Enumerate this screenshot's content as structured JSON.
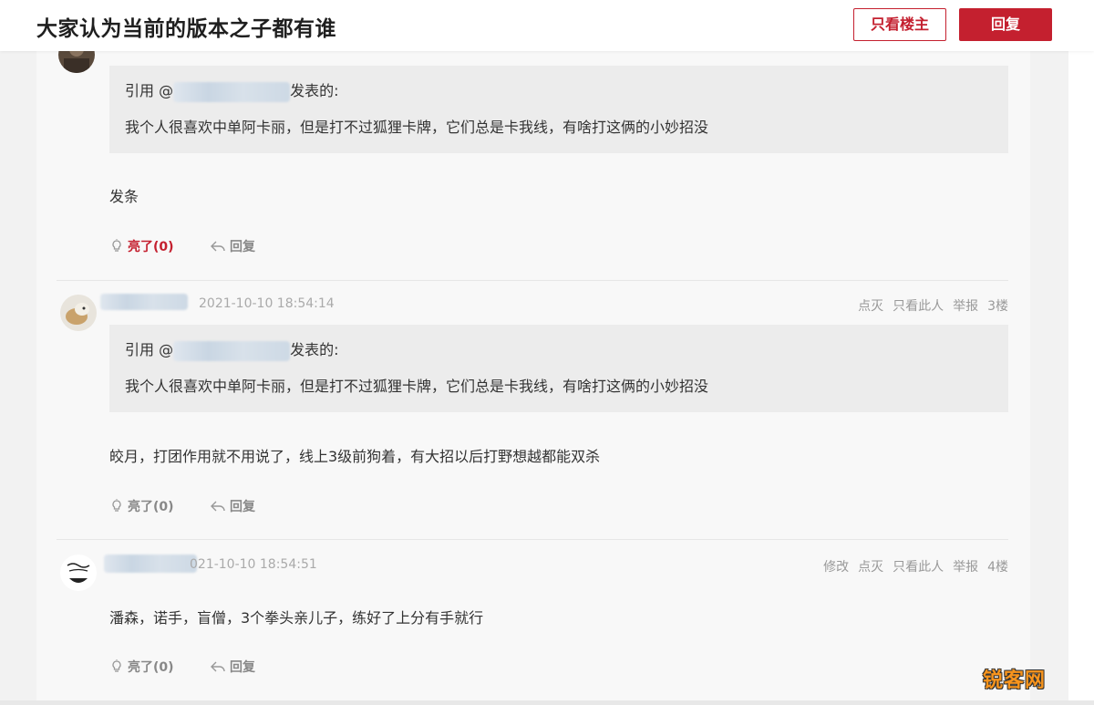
{
  "header": {
    "title": "大家认为当前的版本之子都有谁",
    "only_op_label": "只看楼主",
    "reply_label": "回复"
  },
  "posts": [
    {
      "quote_prefix": "引用 @",
      "quote_suffix": "发表的:",
      "quote_text": "我个人很喜欢中单阿卡丽，但是打不过狐狸卡牌，它们总是卡我线，有啥打这俩的小妙招没",
      "content": "发条",
      "like_label": "亮了(0)",
      "reply_label": "回复"
    },
    {
      "time": "2021-10-10 18:54:14",
      "menu": [
        "点灭",
        "只看此人",
        "举报",
        "3楼"
      ],
      "quote_prefix": "引用 @",
      "quote_suffix": "发表的:",
      "quote_text": "我个人很喜欢中单阿卡丽，但是打不过狐狸卡牌，它们总是卡我线，有啥打这俩的小妙招没",
      "content": "皎月，打团作用就不用说了，线上3级前狗着，有大招以后打野想越都能双杀",
      "like_label": "亮了(0)",
      "reply_label": "回复"
    },
    {
      "time": "021-10-10 18:54:51",
      "menu": [
        "修改",
        "点灭",
        "只看此人",
        "举报",
        "4楼"
      ],
      "content": "潘森，诺手，盲僧，3个拳头亲儿子，练好了上分有手就行",
      "like_label": "亮了(0)",
      "reply_label": "回复"
    }
  ],
  "watermark": "锐客网",
  "colors": {
    "accent": "#c4202f",
    "watermark": "#f7941d"
  }
}
